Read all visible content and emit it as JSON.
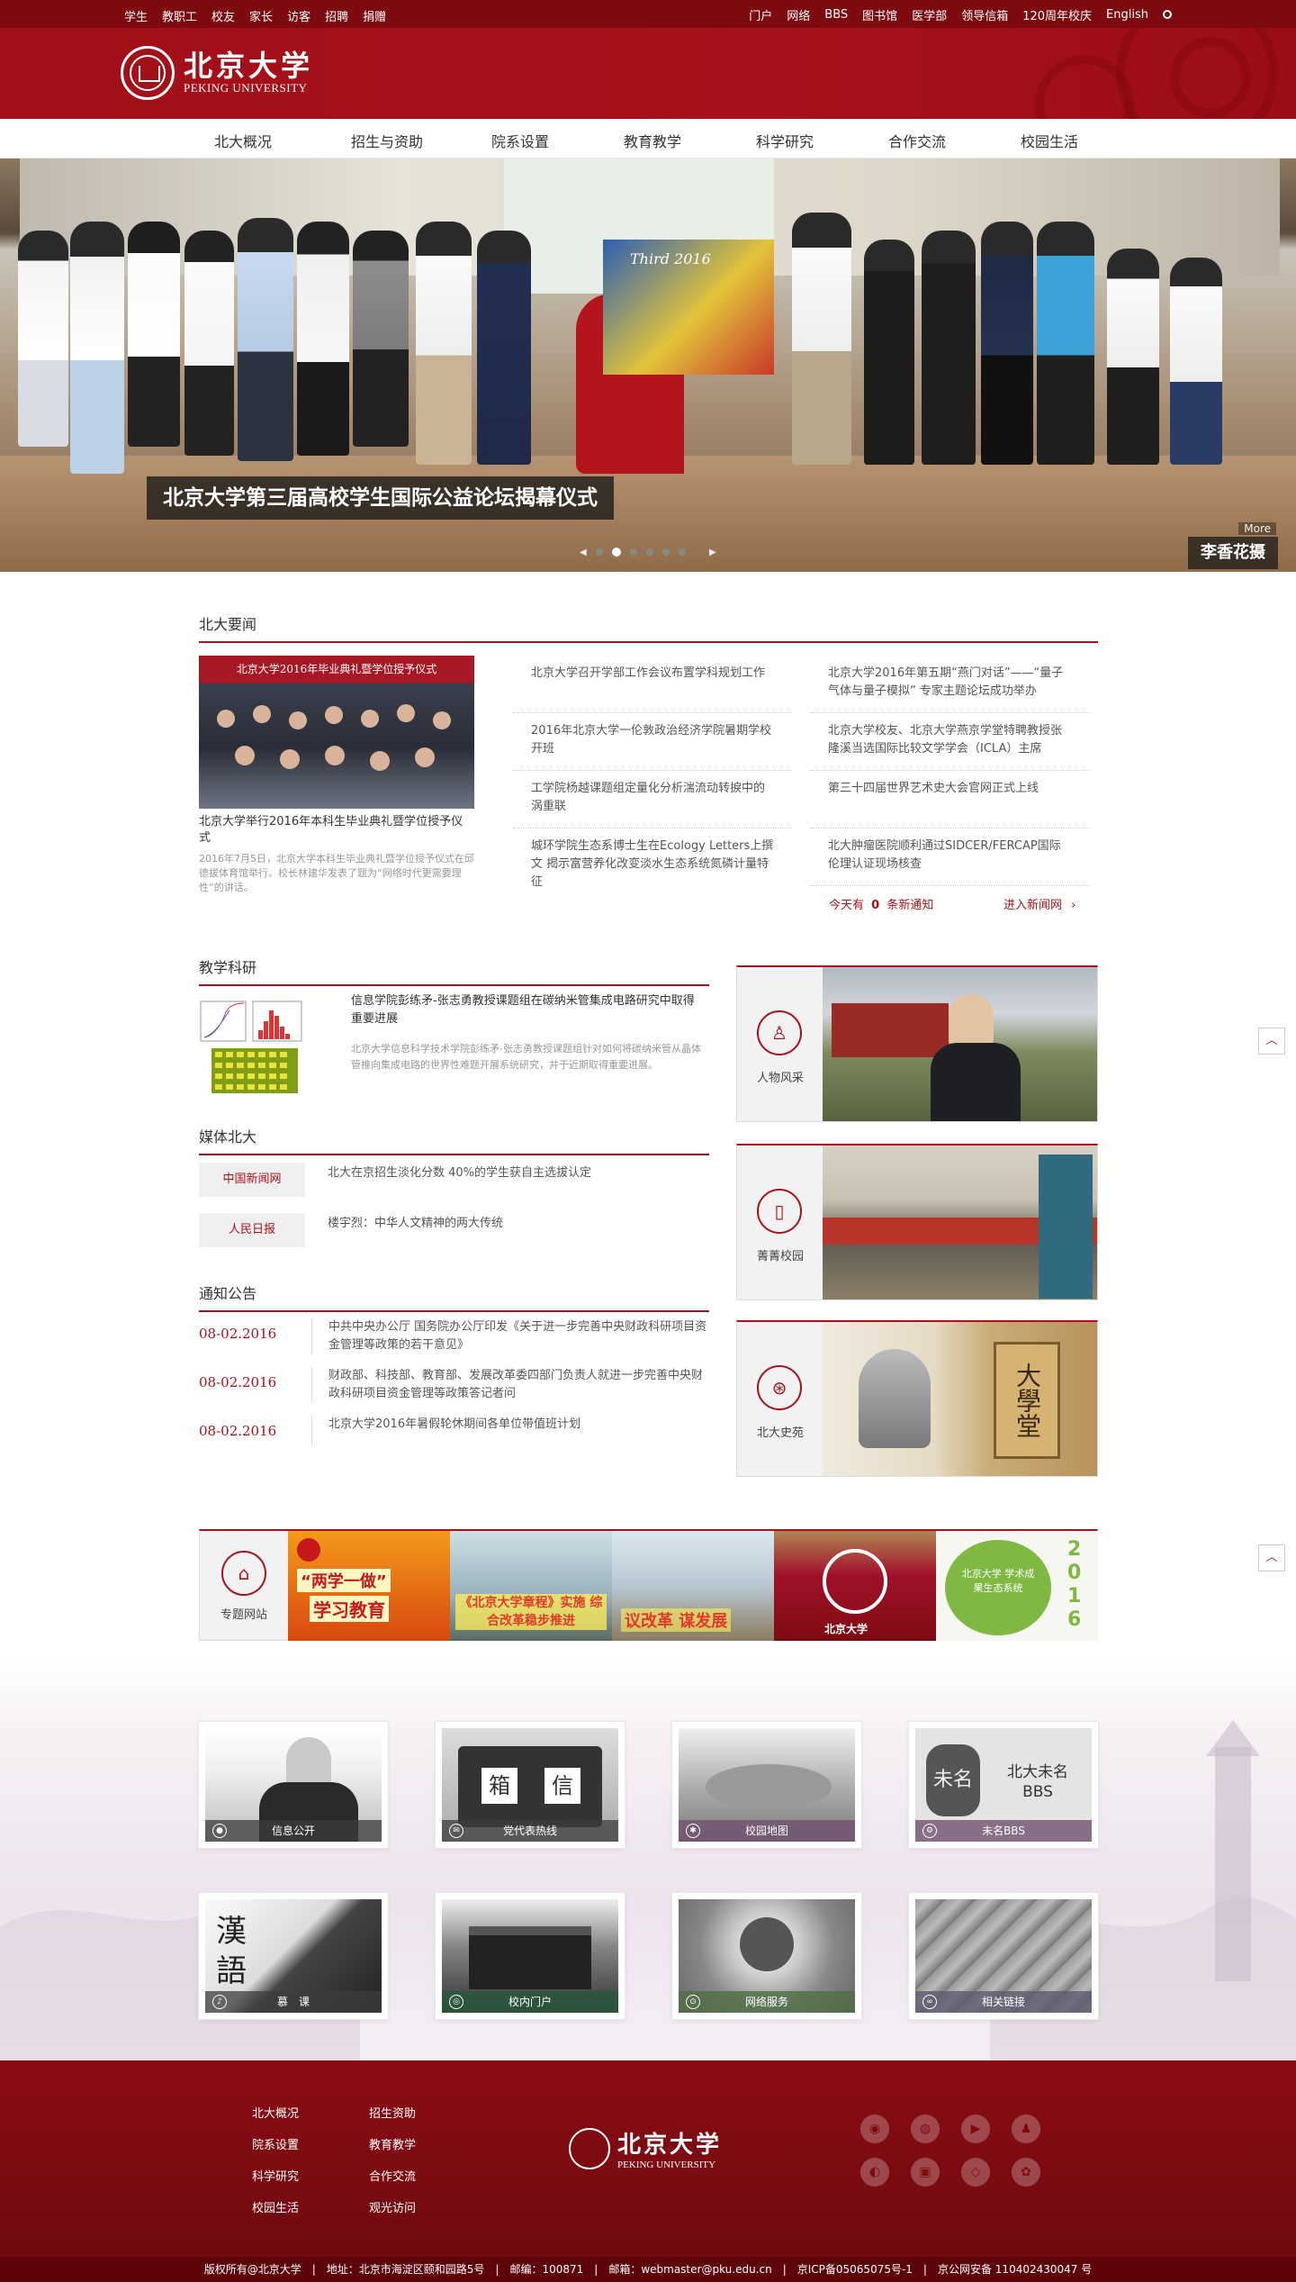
{
  "topbar": {
    "left": [
      "学生",
      "教职工",
      "校友",
      "家长",
      "访客",
      "招聘",
      "捐赠"
    ],
    "right": [
      "门户",
      "网络",
      "BBS",
      "图书馆",
      "医学部",
      "领导信箱",
      "120周年校庆",
      "English"
    ]
  },
  "logo": {
    "cn": "北京大学",
    "en": "PEKING UNIVERSITY"
  },
  "nav": [
    "北大概况",
    "招生与资助",
    "院系设置",
    "教育教学",
    "科学研究",
    "合作交流",
    "校园生活"
  ],
  "banner": {
    "caption": "北京大学第三届高校学生国际公益论坛揭幕仪式",
    "credit": "李香花摄",
    "more": "More",
    "easel_text": "Third 2016"
  },
  "news": {
    "title": "北大要闻",
    "image_band": "北京大学2016年毕业典礼暨学位授予仪式",
    "feature_title": "北京大学举行2016年本科生毕业典礼暨学位授予仪式",
    "feature_desc": "2016年7月5日，北京大学本科生毕业典礼暨学位授予仪式在邱德拔体育馆举行。校长林建华发表了题为“网络时代更需要理性”的讲话。",
    "col1": [
      "北京大学召开学部工作会议布置学科规划工作",
      "2016年北京大学一伦敦政治经济学院暑期学校开班",
      "工学院杨越课题组定量化分析湍流动转捩中的涡重联",
      "城环学院生态系博士生在Ecology Letters上撰文 揭示富营养化改变淡水生态系统氮磷计量特征"
    ],
    "col2": [
      "北京大学2016年第五期“燕门对话”——“量子气体与量子模拟” 专家主题论坛成功举办",
      "北京大学校友、北京大学燕京学堂特聘教授张隆溪当选国际比较文学学会（ICLA）主席",
      "第三十四届世界艺术史大会官网正式上线",
      "北大肿瘤医院顺利通过SIDCER/FERCAP国际伦理认证现场核查"
    ],
    "today": "今天有",
    "today_count": "0",
    "today_suffix": "条新通知",
    "enter": "进入新闻网"
  },
  "teaching": {
    "title": "教学科研",
    "headline": "信息学院彭练矛-张志勇教授课题组在碳纳米管集成电路研究中取得重要进展",
    "desc": "北京大学信息科学技术学院彭练矛-张志勇教授课题组针对如何将碳纳米管从晶体管推向集成电路的世界性难题开展系统研究，并于近期取得重要进展。"
  },
  "media": {
    "title": "媒体北大",
    "items": [
      {
        "source": "中国新闻网",
        "text": "北大在京招生淡化分数 40%的学生获自主选拔认定"
      },
      {
        "source": "人民日报",
        "text": "楼宇烈：中华人文精神的两大传统"
      }
    ]
  },
  "notices": {
    "title": "通知公告",
    "items": [
      {
        "date": "08-02.2016",
        "text": "中共中央办公厅 国务院办公厅印发《关于进一步完善中央财政科研项目资金管理等政策的若干意见》"
      },
      {
        "date": "08-02.2016",
        "text": "财政部、科技部、教育部、发展改革委四部门负责人就进一步完善中央财政科研项目资金管理等政策答记者问"
      },
      {
        "date": "08-02.2016",
        "text": "北京大学2016年暑假轮休期间各单位带值班计划"
      }
    ]
  },
  "sidecards": [
    {
      "label": "人物风采",
      "icon": "chair-icon"
    },
    {
      "label": "菁菁校园",
      "icon": "door-icon"
    },
    {
      "label": "北大史苑",
      "icon": "seal-icon"
    }
  ],
  "sidecard_photo3_text": "大學堂",
  "special": {
    "label": "专题网站",
    "banners": [
      "“两学一做”学习教育",
      "《北京大学章程》实施综合改革稳步推进",
      "议改革 谋发展",
      "",
      "北京大学 学术成果生态系统 2016"
    ]
  },
  "special_texts": {
    "b1a": "“两学一做”",
    "b1b": "学习教育",
    "b2": "《北京大学章程》实施 综合改革稳步推进",
    "b3": "议改革 谋发展",
    "b4": "北京大学",
    "b5": "北京大学 学术成果生态系统",
    "b5_year": "2016"
  },
  "tiles": [
    {
      "label": "信息公开"
    },
    {
      "label": "党代表热线"
    },
    {
      "label": "校园地图"
    },
    {
      "label": "未名BBS"
    },
    {
      "label": "慕　课"
    },
    {
      "label": "校内门户"
    },
    {
      "label": "网络服务"
    },
    {
      "label": "相关链接"
    }
  ],
  "tile_texts": {
    "bbs": "北大未名 BBS",
    "bbs_badge": "未名",
    "mooc1": "漢",
    "mooc2": "語",
    "box1": "箱",
    "box2": "信"
  },
  "footer": {
    "links": [
      "北大概况",
      "招生资助",
      "院系设置",
      "教育教学",
      "科学研究",
      "合作交流",
      "校园生活",
      "观光访问"
    ],
    "social": [
      "微博",
      "微信",
      "优酷",
      "QQ",
      "人人",
      "豆瓣",
      "网易",
      "花瓣"
    ]
  },
  "copyright": "版权所有@北京大学　|　地址：北京市海淀区颐和园路5号　|　邮编：100871　|　邮箱：webmaster@pku.edu.cn　|　京ICP备05065075号-1　|　京公网安备 110402430047 号",
  "colors": {
    "brand": "#a8121b",
    "topbar": "#7d0a0f"
  }
}
